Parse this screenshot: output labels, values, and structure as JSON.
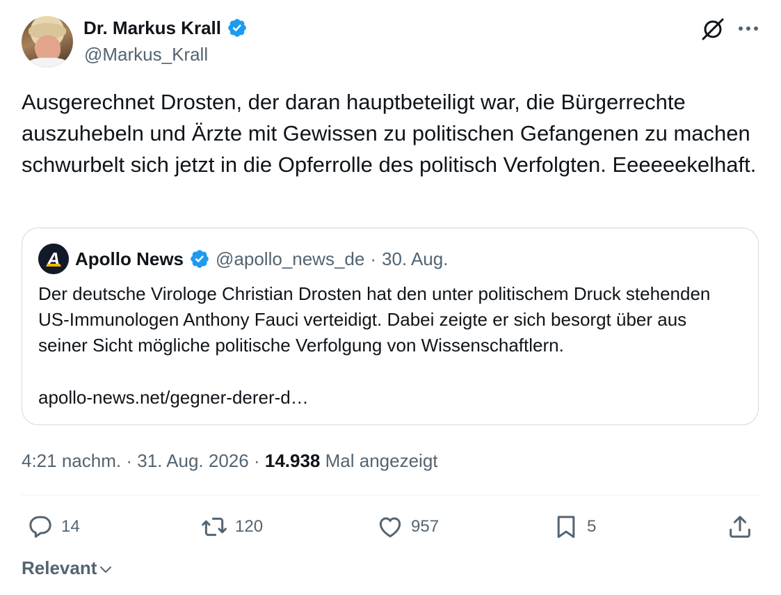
{
  "author": {
    "display_name": "Dr. Markus Krall",
    "handle": "@Markus_Krall",
    "verified": true
  },
  "header_icons": {
    "grok": "grok-icon",
    "more": "more-icon"
  },
  "tweet": {
    "text": "Ausgerechnet Drosten, der daran hauptbeteiligt war, die Bürgerrechte auszuhebeln und Ärzte mit Gewissen zu politischen Gefangenen zu machen schwurbelt sich jetzt in die Opferrolle des politisch Verfolgten. Eeeeeekelhaft."
  },
  "quote": {
    "avatar_letter": "A",
    "display_name": "Apollo News",
    "handle": "@apollo_news_de",
    "separator": "·",
    "date": "30. Aug.",
    "text": "Der deutsche Virologe Christian Drosten hat den unter politischem Druck stehenden US-Immunologen Anthony Fauci verteidigt. Dabei zeigte er sich besorgt über aus seiner Sicht mögliche politische Verfolgung von Wissenschaftlern.",
    "link": "apollo-news.net/gegner-derer-d…"
  },
  "meta": {
    "time": "4:21 nachm.",
    "sep1": "·",
    "date": "31. Aug. 2026",
    "sep2": "·",
    "views": "14.938",
    "views_label": "Mal angezeigt"
  },
  "actions": {
    "replies": "14",
    "reposts": "120",
    "likes": "957",
    "bookmarks": "5"
  },
  "sort": {
    "label": "Relevant"
  },
  "colors": {
    "verified_blue": "#1d9bf0",
    "secondary_text": "#536471",
    "primary_text": "#0f1419",
    "border": "#cfd9de",
    "apollo_yellow": "#f5b800"
  }
}
